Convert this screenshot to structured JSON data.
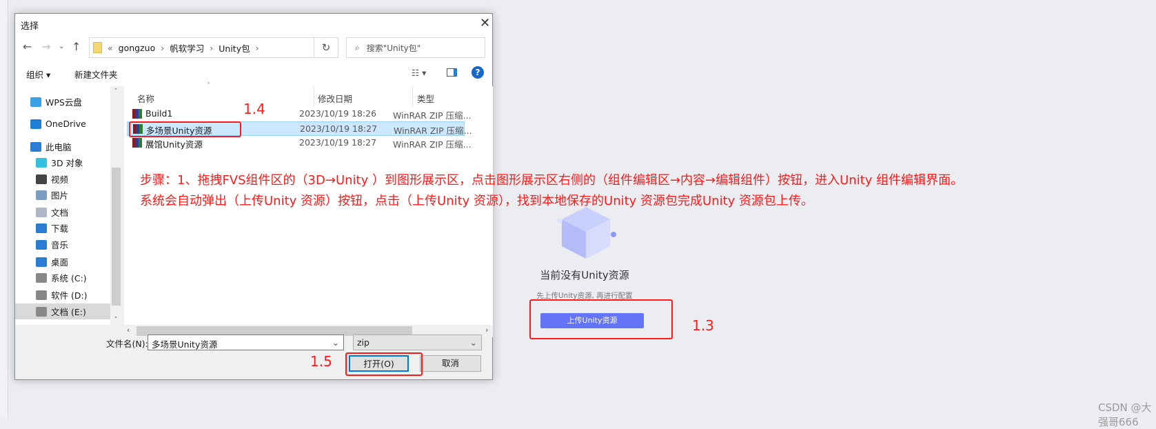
{
  "dialog": {
    "title": "选择",
    "breadcrumb": [
      "«",
      "gongzuo",
      "›",
      "帆软学习",
      "›",
      "Unity包",
      "›"
    ],
    "search_placeholder": "搜索\"Unity包\"",
    "toolbar": {
      "organize": "组织 ▾",
      "new_folder": "新建文件夹"
    },
    "nav_items": [
      {
        "label": "WPS云盘",
        "icon": "cloud-icon",
        "color": "#3aa0e8"
      },
      {
        "label": "OneDrive",
        "icon": "onedrive-icon",
        "color": "#1e7fd8"
      },
      {
        "label": "此电脑",
        "icon": "computer-icon",
        "color": "#2b7cd3"
      },
      {
        "label": "3D 对象",
        "icon": "cube-icon",
        "color": "#35c0e0"
      },
      {
        "label": "视频",
        "icon": "video-icon",
        "color": "#444"
      },
      {
        "label": "图片",
        "icon": "picture-icon",
        "color": "#7a9cc0"
      },
      {
        "label": "文档",
        "icon": "document-icon",
        "color": "#b0b8c8"
      },
      {
        "label": "下载",
        "icon": "download-icon",
        "color": "#2b7cd3"
      },
      {
        "label": "音乐",
        "icon": "music-icon",
        "color": "#2b7cd3"
      },
      {
        "label": "桌面",
        "icon": "desktop-icon",
        "color": "#2b7cd3"
      },
      {
        "label": "系统 (C:)",
        "icon": "drive-icon",
        "color": "#888"
      },
      {
        "label": "软件 (D:)",
        "icon": "drive-icon",
        "color": "#888"
      },
      {
        "label": "文档 (E:)",
        "icon": "drive-icon",
        "color": "#888",
        "selected": true
      }
    ],
    "columns": {
      "name": "名称",
      "date": "修改日期",
      "type": "类型"
    },
    "files": [
      {
        "name": "Build1",
        "date": "2023/10/19 18:26",
        "type": "WinRAR ZIP 压缩..."
      },
      {
        "name": "多场景Unity资源",
        "date": "2023/10/19 18:27",
        "type": "WinRAR ZIP 压缩...",
        "selected": true
      },
      {
        "name": "展馆Unity资源",
        "date": "2023/10/19 18:27",
        "type": "WinRAR ZIP 压缩..."
      }
    ],
    "filename_label": "文件名(N):",
    "filename_value": "多场景Unity资源",
    "filter_value": "zip",
    "open_button": "打开(O)",
    "cancel_button": "取消"
  },
  "annotations": {
    "step_1_4": "1.4",
    "step_1_5": "1.5",
    "step_1_3": "1.3",
    "line1": "步骤：1、拖拽FVS组件区的（3D→Unity ）到图形展示区，点击图形展示区右侧的（组件编辑区→内容→编辑组件）按钮，进入Unity 组件编辑界面。",
    "line2": "系统会自动弹出（上传Unity 资源）按钮，点击（上传Unity 资源），找到本地保存的Unity 资源包完成Unity 资源包上传。",
    "color": "#ff1a1a"
  },
  "empty_state": {
    "title": "当前没有Unity资源",
    "subtitle": "先上传Unity资源, 再进行配置",
    "button": "上传Unity资源",
    "button_color": "#6474f8"
  },
  "watermark": "CSDN @大强哥666"
}
